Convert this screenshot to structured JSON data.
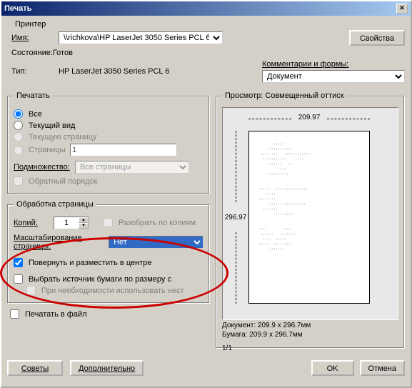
{
  "title": "Печать",
  "printer": {
    "name_label": "Имя:",
    "name_value": "\\\\richkova\\HP LaserJet 3050 Series PCL 6",
    "status_label": "Состояние:Готов",
    "type_label": "Тип:",
    "type_value": "HP LaserJet 3050 Series PCL 6",
    "properties_btn": "Свойства",
    "comments_label": "Комментарии и формы:",
    "comments_value": "Документ",
    "section_label": "Принтер"
  },
  "range": {
    "legend": "Печатать",
    "all": "Все",
    "current_view": "Текущий вид",
    "current_page": "Текущую страницу",
    "pages": "Страницы",
    "pages_value": "1",
    "subset_label": "Подмножество:",
    "subset_value": "Все страницы",
    "reverse": "Обратный порядок"
  },
  "handling": {
    "legend": "Обработка страницы",
    "copies_label": "Копий:",
    "copies_value": "1",
    "collate": "Разобрать по копиям",
    "scaling_label": "Масштабирование страницы:",
    "scaling_value": "Нет",
    "rotate": "Повернуть и разместить в центре",
    "paper_source": "Выбрать источник бумаги по размеру с",
    "use_custom": "При необходимости использовать нест"
  },
  "print_to_file": "Печатать в файл",
  "preview": {
    "legend": "Просмотр: Совмещенный оттиск",
    "width": "209.97",
    "height": "296.97",
    "doc_line": "Документ: 209.9 x 296.7мм",
    "paper_line": "Бумага: 209.9 x 296.7мм",
    "page_counter": "1/1"
  },
  "buttons": {
    "tips": "Советы",
    "advanced": "Дополнительно",
    "ok": "OK",
    "cancel": "Отмена"
  }
}
